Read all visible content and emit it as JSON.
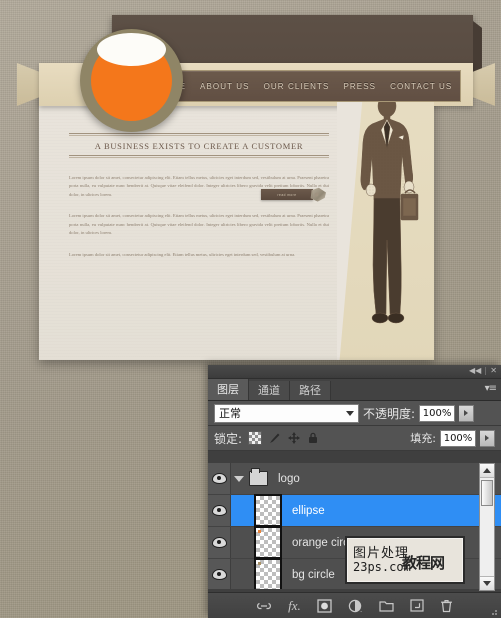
{
  "website": {
    "nav": [
      {
        "label": "HOME"
      },
      {
        "label": "ABOUT US"
      },
      {
        "label": "OUR CLIENTS"
      },
      {
        "label": "PRESS"
      },
      {
        "label": "CONTACT US"
      }
    ],
    "headline": "A BUSINESS EXISTS TO CREATE A CUSTOMER",
    "paragraphs": [
      "Lorem ipsum dolor sit amet, consectetur adipiscing elit. Etiam tellus metus, ultricies eget interdum sed, vestibulum at urna. Praesent pharetra porta nulla, eu vulputate nunc hendrerit at. Quisque vitae eleifend dolor. Integer ultricies libero gravida velit pretium lobortis. Nulla et dui dolor, in ultrices lorem.",
      "Lorem ipsum dolor sit amet, consectetur adipiscing elit. Etiam tellus metus, ultricies eget interdum sed, vestibulum at urna. Praesent pharetra porta nulla, eu vulputate nunc hendrerit at. Quisque vitae eleifend dolor. Integer ultricies libero gravida velit pretium lobortis. Nulla et dui dolor, in ultrices lorem.",
      "Lorem ipsum dolor sit amet, consectetur adipiscing elit. Etiam tellus metus, ultricies eget interdum sed, vestibulum at urna."
    ],
    "read_more": "read more",
    "colors": {
      "header_brown": "#584b41",
      "logo_orange": "#f4771b",
      "logo_ring": "#8f8566",
      "ribbon_cream": "#e0d3b4",
      "page_bg": "#e7e2da",
      "panel_tan": "#e5dbbe"
    }
  },
  "panel": {
    "titlebar": {
      "collapse_icon": "◀◀",
      "close_icon": "✕"
    },
    "tabs": [
      {
        "label": "图层",
        "active": true
      },
      {
        "label": "通道",
        "active": false
      },
      {
        "label": "路径",
        "active": false
      }
    ],
    "menu_icon": "▾≡",
    "blend_mode": {
      "label": "",
      "value": "正常"
    },
    "opacity": {
      "label": "不透明度:",
      "value": "100%"
    },
    "lock": {
      "label": "锁定:",
      "icons": [
        "transparency-checker-icon",
        "brush-icon",
        "move-icon",
        "lock-icon"
      ]
    },
    "fill": {
      "label": "填充:",
      "value": "100%"
    },
    "layers": [
      {
        "name": "logo",
        "type": "group",
        "selected": false,
        "visible": true,
        "dot": ""
      },
      {
        "name": "ellipse",
        "type": "layer",
        "selected": true,
        "visible": true,
        "dot": ""
      },
      {
        "name": "orange circle",
        "type": "layer",
        "selected": false,
        "visible": true,
        "dot": "#e8833a"
      },
      {
        "name": "bg circle",
        "type": "layer",
        "selected": false,
        "visible": true,
        "dot": "#a99268"
      }
    ],
    "footer_icons": [
      {
        "name": "link-layers-icon",
        "glyph": "⛓"
      },
      {
        "name": "layer-style-fx-icon",
        "glyph": "fx."
      },
      {
        "name": "add-layer-mask-icon",
        "glyph": "◙"
      },
      {
        "name": "adjustment-layer-icon",
        "glyph": "◕."
      },
      {
        "name": "new-group-icon",
        "glyph": "▭"
      },
      {
        "name": "new-layer-icon",
        "glyph": "▣"
      },
      {
        "name": "delete-layer-icon",
        "glyph": "🗑"
      }
    ],
    "scrollbar": {
      "up_arrow": "▲",
      "down_arrow": "▼"
    }
  },
  "watermark": {
    "line1": "图片处理",
    "line2": "23ps.com",
    "overlay": "教程网"
  }
}
